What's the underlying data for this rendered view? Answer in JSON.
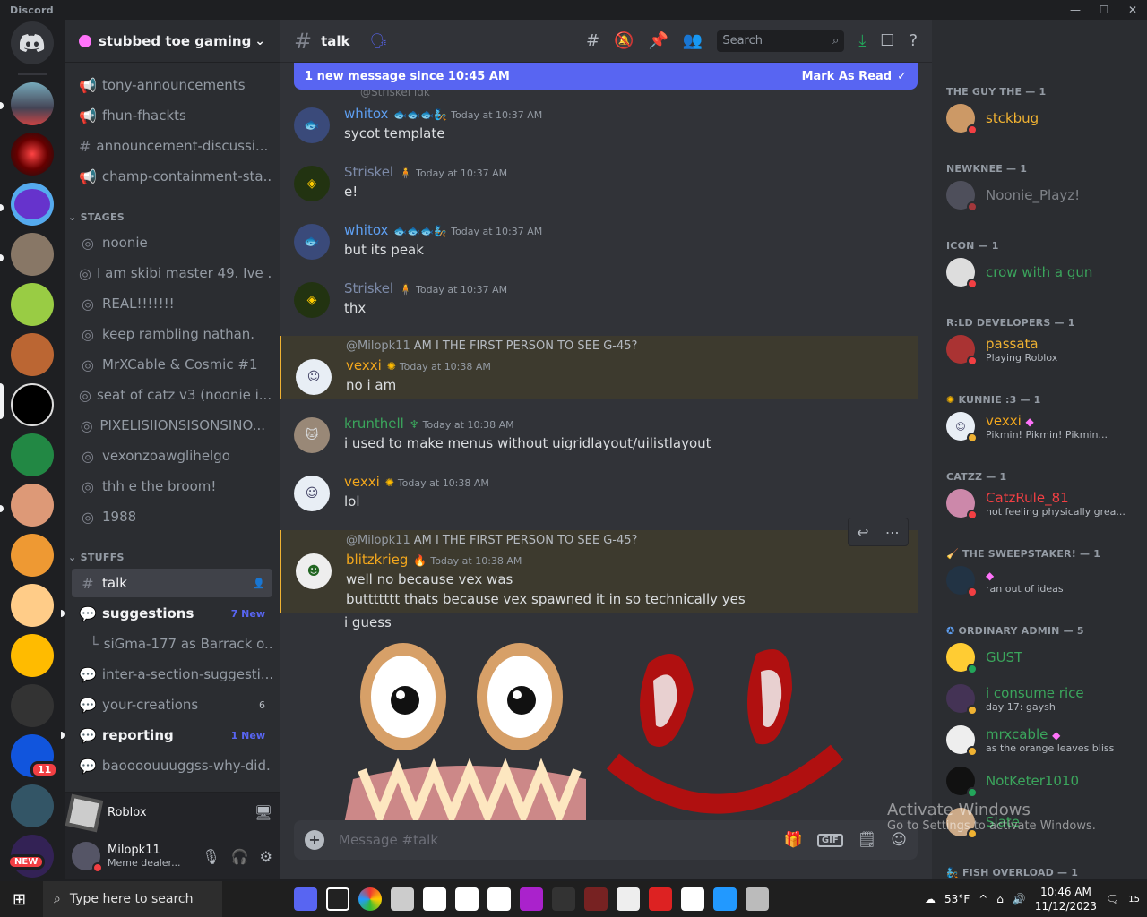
{
  "app": {
    "title": "Discord",
    "window_buttons": [
      "—",
      "☐",
      "✕"
    ]
  },
  "servers": [
    {
      "badge": ""
    },
    {
      "badge": ""
    },
    {
      "badge": ""
    },
    {
      "badge": ""
    },
    {
      "badge": ""
    },
    {
      "badge": ""
    },
    {
      "badge": ""
    },
    {
      "badge": ""
    },
    {
      "badge": ""
    },
    {
      "badge": ""
    },
    {
      "badge": ""
    },
    {
      "badge": ""
    },
    {
      "badge": ""
    },
    {
      "badge": ""
    },
    {
      "badge": "11"
    },
    {
      "badge": ""
    },
    {
      "badge": "NEW"
    }
  ],
  "server_header": {
    "name": "stubbed toe gaming"
  },
  "channels": {
    "top": [
      {
        "label": "tony-announcements"
      },
      {
        "label": "fhun-fhackts"
      },
      {
        "label": "announcement-discussi..."
      },
      {
        "label": "champ-containment-sta..."
      }
    ],
    "stages_category": "STAGES",
    "stages": [
      {
        "label": "noonie"
      },
      {
        "label": "I am skibi master 49. Ive ..."
      },
      {
        "label": "REAL!!!!!!!"
      },
      {
        "label": "keep rambling nathan."
      },
      {
        "label": "MrXCable & Cosmic #1"
      },
      {
        "label": "seat of catz v3 (noonie i..."
      },
      {
        "label": "PIXELISIIONSISONSINO..."
      },
      {
        "label": "vexonzoawglihelgo"
      },
      {
        "label": "thh e the broom!"
      },
      {
        "label": "1988"
      }
    ],
    "stuffs_category": "STUFFS",
    "stuffs": [
      {
        "label": "talk",
        "badge": ""
      },
      {
        "label": "suggestions",
        "badge": "7 New"
      },
      {
        "label": "siGma-177 as Barrack o...",
        "badge": ""
      },
      {
        "label": "inter-a-section-suggesti...",
        "badge": ""
      },
      {
        "label": "your-creations",
        "badge": "6"
      },
      {
        "label": "reporting",
        "badge": "1 New"
      },
      {
        "label": "baoooouuuggss-why-did...",
        "badge": ""
      }
    ]
  },
  "activity": {
    "label": "Roblox"
  },
  "user": {
    "name": "Milopk11",
    "status": "Meme dealer..."
  },
  "chat": {
    "channel": "talk",
    "new_banner": "1 new message since 10:45 AM",
    "mark_read": "Mark As Read",
    "search_placeholder": "Search",
    "composer_placeholder": "Message #talk",
    "top_reply_fragment": "@Striskel idk",
    "messages": [
      {
        "user": "whitox",
        "time": "Today at 10:37 AM",
        "text": "sycot template",
        "color": "#5e9ff2"
      },
      {
        "user": "Striskel",
        "time": "Today at 10:37 AM",
        "text": "e!",
        "color": "#7c8aa8"
      },
      {
        "user": "whitox",
        "time": "Today at 10:37 AM",
        "text": "but its peak",
        "color": "#5e9ff2"
      },
      {
        "user": "Striskel",
        "time": "Today at 10:37 AM",
        "text": "thx",
        "color": "#7c8aa8"
      },
      {
        "user": "vexxi",
        "time": "Today at 10:38 AM",
        "text": "no i am",
        "color": "#f2a71d",
        "reply_user": "@Milopk11",
        "reply_text": "AM I THE FIRST PERSON TO SEE G-45?"
      },
      {
        "user": "krunthell",
        "time": "Today at 10:38 AM",
        "text": "i used to make menus without uigridlayout/uilistlayout",
        "color": "#3ba55c"
      },
      {
        "user": "vexxi",
        "time": "Today at 10:38 AM",
        "text": "lol",
        "color": "#f2a71d"
      },
      {
        "user": "blitzkrieg",
        "time": "Today at 10:38 AM",
        "text": "well no because vex was",
        "text2": "buttttttt thats because vex spawned it in so technically yes",
        "text3": "i guess",
        "color": "#f2a71d",
        "reply_user": "@Milopk11",
        "reply_text": "AM I THE FIRST PERSON TO SEE G-45?"
      }
    ]
  },
  "members": {
    "categories": [
      {
        "label": "THE GUY THE — 1"
      },
      {
        "label": "NEWKNEE — 1"
      },
      {
        "label": "ICON — 1"
      },
      {
        "label": "R:LD DEVELOPERS — 1"
      },
      {
        "label": "KUNNIE :3 — 1"
      },
      {
        "label": "CATZZ — 1"
      },
      {
        "label": "THE SWEEPSTAKER! — 1"
      },
      {
        "label": "ORDINARY ADMIN — 5"
      },
      {
        "label": "FISH OVERLOAD — 1"
      }
    ],
    "list": [
      {
        "name": "stckbug",
        "sub": "",
        "color": "#f0b232",
        "status": "#f23f43"
      },
      {
        "name": "Noonie_Playz!",
        "sub": "",
        "color": "#949ba4",
        "status": "#f23f43"
      },
      {
        "name": "crow with a gun",
        "sub": "",
        "color": "#3ba55c",
        "status": "#f23f43"
      },
      {
        "name": "passata",
        "sub": "Playing Roblox",
        "color": "#f0b232",
        "status": "#f23f43"
      },
      {
        "name": "vexxi",
        "sub": "Pikmin! Pikmin! Pikmin...",
        "color": "#f2a71d",
        "status": "#f0b232"
      },
      {
        "name": "CatzRule_81",
        "sub": "not feeling physically grea...",
        "color": "#f23f43",
        "status": "#f23f43"
      },
      {
        "name": "",
        "sub": "ran out of ideas",
        "color": "#949ba4",
        "status": "#f23f43"
      },
      {
        "name": "GUST",
        "sub": "",
        "color": "#3ba55c",
        "status": "#23a55a"
      },
      {
        "name": "i consume rice",
        "sub": "day 17: gaysh",
        "color": "#3ba55c",
        "status": "#f0b232"
      },
      {
        "name": "mrxcable",
        "sub": "as the orange leaves bliss",
        "color": "#3ba55c",
        "status": "#f0b232"
      },
      {
        "name": "NotKeter1010",
        "sub": "",
        "color": "#3ba55c",
        "status": "#23a55a"
      },
      {
        "name": "Slate",
        "sub": "",
        "color": "#3ba55c",
        "status": "#f0b232"
      }
    ]
  },
  "watermark": {
    "line1": "Activate Windows",
    "line2": "Go to Settings to activate Windows."
  },
  "taskbar": {
    "search": "Type here to search",
    "temp": "53°F",
    "time": "10:46 AM",
    "date": "11/12/2023",
    "notif": "15"
  }
}
